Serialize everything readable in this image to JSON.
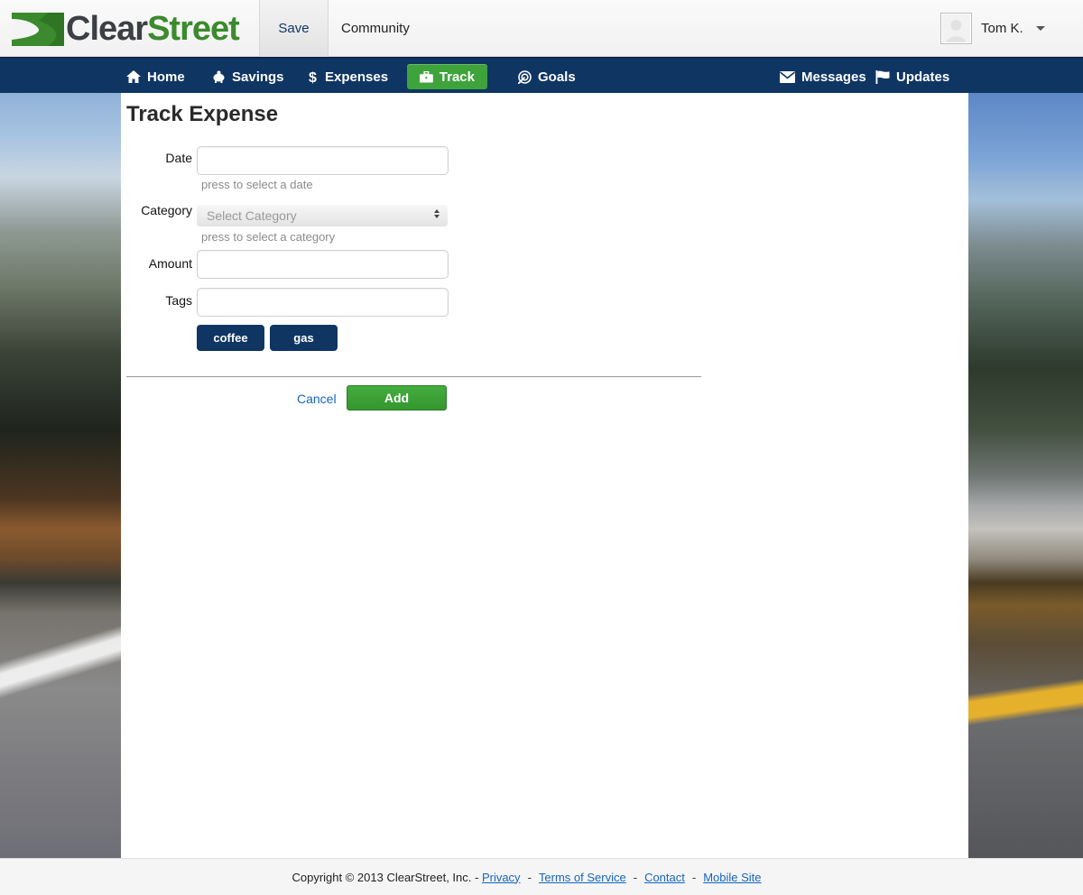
{
  "brand": {
    "name_part1": "Clear",
    "name_part2": "Street",
    "green": "#3b8a2d",
    "navy": "#0f3563"
  },
  "top_tabs": {
    "save": "Save",
    "community": "Community"
  },
  "user": {
    "name": "Tom K."
  },
  "nav": {
    "home": "Home",
    "savings": "Savings",
    "expenses": "Expenses",
    "track": "Track",
    "goals": "Goals",
    "messages": "Messages",
    "updates": "Updates"
  },
  "form": {
    "title": "Track Expense",
    "date_label": "Date",
    "date_value": "",
    "date_hint": "press to select a date",
    "category_label": "Category",
    "category_placeholder": "Select Category",
    "category_hint": "press to select a category",
    "amount_label": "Amount",
    "amount_value": "",
    "tags_label": "Tags",
    "tags_value": "",
    "tag_chips": [
      "coffee",
      "gas"
    ],
    "cancel_label": "Cancel",
    "add_label": "Add"
  },
  "footer": {
    "copyright": "Copyright © 2013 ClearStreet, Inc. -",
    "privacy": "Privacy",
    "terms": "Terms of Service",
    "contact": "Contact",
    "mobile": "Mobile Site",
    "separator": "-"
  },
  "icons": {
    "home": "home-icon",
    "savings": "piggy-bank-icon",
    "expenses": "dollar-icon",
    "track": "briefcase-icon",
    "goals": "target-icon",
    "messages": "envelope-icon",
    "updates": "flag-icon"
  }
}
